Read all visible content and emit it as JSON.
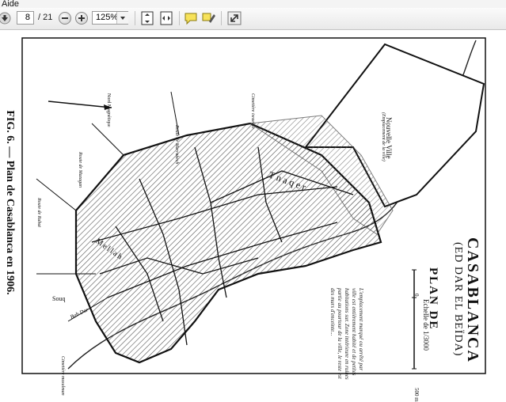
{
  "menubar": {
    "item": "Aide"
  },
  "toolbar": {
    "current_page": "8",
    "page_separator": "/ 21",
    "zoom": "125%",
    "icons": [
      "page-down-icon",
      "zoom-out-icon",
      "zoom-in-icon",
      "fit-page-icon",
      "fit-width-icon",
      "comment-icon",
      "highlight-icon",
      "expand-icon"
    ]
  },
  "document": {
    "caption_fig": "FIG. 6.",
    "caption_text": "— Plan de Casablanca en 1906.",
    "map": {
      "title": "PLAN DE",
      "city": "CASABLANCA",
      "subtitle": "(ED DAR EL BEÏDA)",
      "scale": "Echelle de 1/3000",
      "scale_start": "0",
      "scale_end": "500 m",
      "legend_text": "L'emplacement marqué ou arrêté par ville est entièrement habité et de petites habitations sur. Zone intérieure en ruines partie au pourtour de la ville, le reste est des murs d'enceinte...",
      "labels": {
        "tnaquer": "Tnaqer",
        "nouvelle_ville": "Nouvelle Ville",
        "nouvelle_ville_sub": "(Emplacement de la ville)",
        "mellah": "Mellah",
        "souq": "Souq",
        "nord_magnetique": "Nord Magnétique",
        "cimetiere_israelite": "Cimetière israelite",
        "cimetiere_musulman": "Cimetière musulman",
        "route_marrakech": "Route de Marrakech",
        "route_mazagan": "Route de Mazagan",
        "route_rabat": "Route de Rabat",
        "bab_dar": "Bab Dar"
      }
    }
  }
}
